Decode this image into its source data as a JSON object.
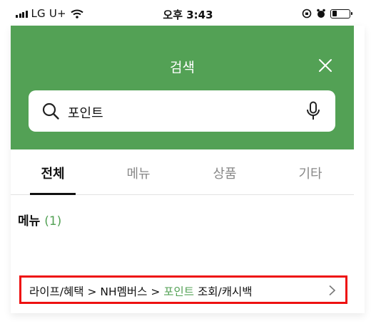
{
  "status_bar": {
    "carrier": "LG U+",
    "time": "오후 3:43"
  },
  "header": {
    "title": "검색",
    "close_icon": "close-icon"
  },
  "search": {
    "value": "포인트",
    "search_icon": "search-icon",
    "mic_icon": "microphone-icon"
  },
  "tabs": [
    {
      "label": "전체",
      "active": true
    },
    {
      "label": "메뉴",
      "active": false
    },
    {
      "label": "상품",
      "active": false
    },
    {
      "label": "기타",
      "active": false
    }
  ],
  "results": {
    "section_label": "메뉴",
    "section_count": "(1)",
    "items": [
      {
        "path_prefix": "라이프/혜택 > NH멤버스 > ",
        "highlight": "포인트",
        "path_suffix": " 조회/캐시백"
      }
    ]
  },
  "colors": {
    "brand_green": "#53a155",
    "highlight_box": "#ee1111"
  }
}
